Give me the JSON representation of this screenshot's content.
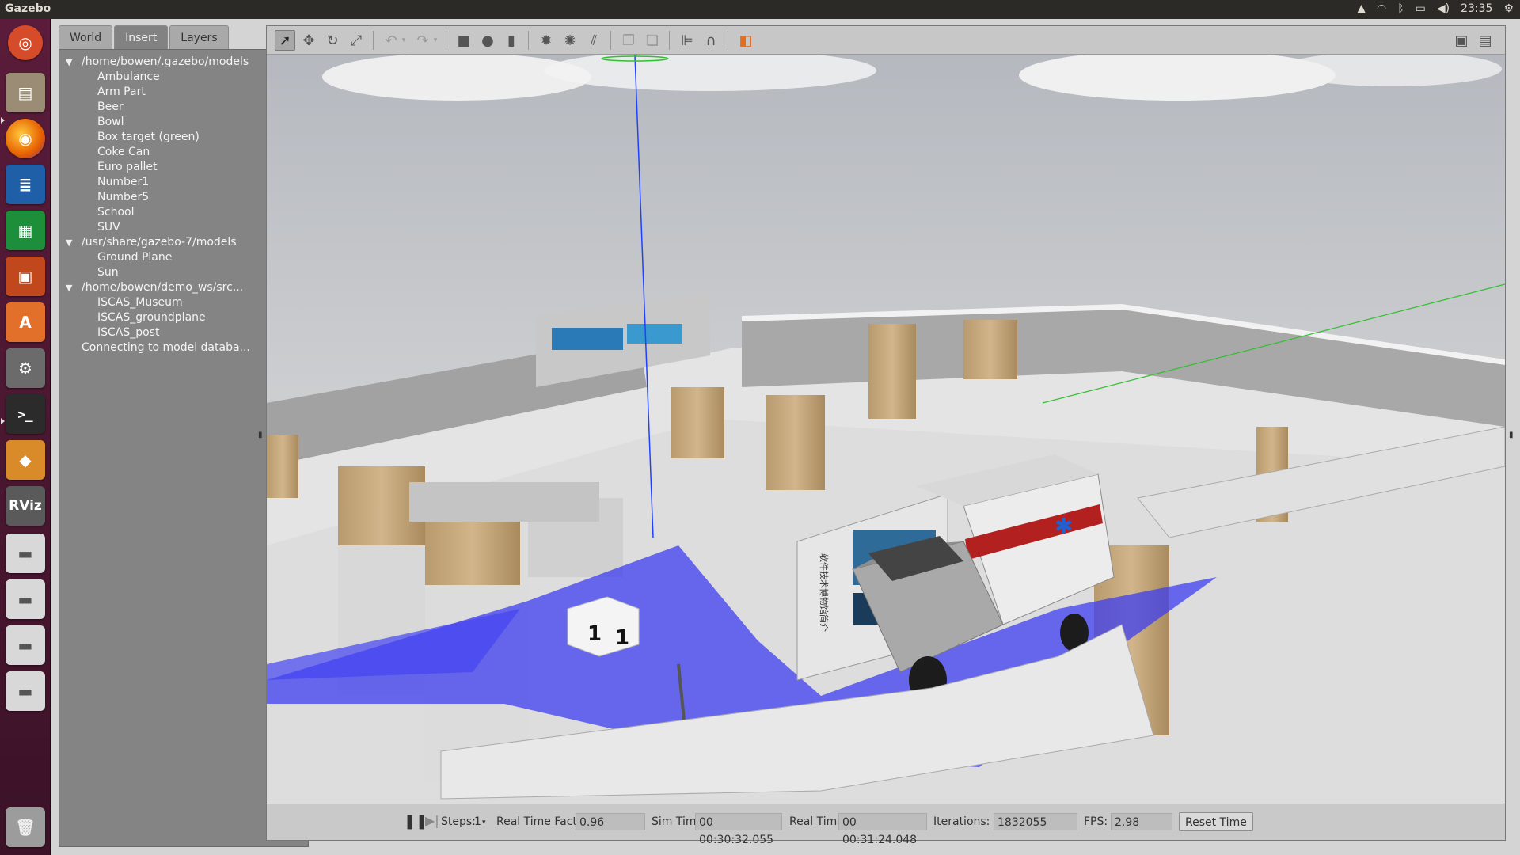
{
  "system": {
    "app_title": "Gazebo",
    "clock": "23:35",
    "tray_icons": [
      "update-icon",
      "wifi-icon",
      "bluetooth-icon",
      "battery-icon",
      "volume-icon",
      "settings-gear-icon"
    ]
  },
  "launcher": {
    "items": [
      {
        "name": "ubuntu-dash-icon",
        "color": "#d64b29"
      },
      {
        "name": "files-icon",
        "color": "#9b8c75"
      },
      {
        "name": "firefox-icon",
        "color": "#e66000"
      },
      {
        "name": "writer-icon",
        "color": "#1f5fa8"
      },
      {
        "name": "calc-icon",
        "color": "#1d8f3b"
      },
      {
        "name": "impress-icon",
        "color": "#c0481c"
      },
      {
        "name": "software-center-icon",
        "color": "#e2702a"
      },
      {
        "name": "system-settings-icon",
        "color": "#6b6b6b"
      },
      {
        "name": "terminal-icon",
        "color": "#2b2b2b"
      },
      {
        "name": "gazebo-icon",
        "color": "#d98b2a"
      },
      {
        "name": "rviz-icon",
        "color": "#5a5a5a"
      },
      {
        "name": "drive-icon",
        "color": "#d8d8d8"
      },
      {
        "name": "drive-icon",
        "color": "#d8d8d8"
      },
      {
        "name": "drive-icon",
        "color": "#d8d8d8"
      },
      {
        "name": "drive-icon",
        "color": "#d8d8d8"
      },
      {
        "name": "trash-icon",
        "color": "#9c9c9c"
      }
    ],
    "rviz_label": "RViz"
  },
  "left_panel": {
    "tabs": [
      {
        "label": "World",
        "active": false
      },
      {
        "label": "Insert",
        "active": true
      },
      {
        "label": "Layers",
        "active": false
      }
    ],
    "tree": [
      {
        "type": "path",
        "label": "/home/bowen/.gazebo/models"
      },
      {
        "type": "model",
        "label": "Ambulance"
      },
      {
        "type": "model",
        "label": "Arm Part"
      },
      {
        "type": "model",
        "label": "Beer"
      },
      {
        "type": "model",
        "label": "Bowl"
      },
      {
        "type": "model",
        "label": "Box target (green)"
      },
      {
        "type": "model",
        "label": "Coke Can"
      },
      {
        "type": "model",
        "label": "Euro pallet"
      },
      {
        "type": "model",
        "label": "Number1"
      },
      {
        "type": "model",
        "label": "Number5"
      },
      {
        "type": "model",
        "label": "School"
      },
      {
        "type": "model",
        "label": "SUV"
      },
      {
        "type": "path",
        "label": "/usr/share/gazebo-7/models"
      },
      {
        "type": "model",
        "label": "Ground Plane"
      },
      {
        "type": "model",
        "label": "Sun"
      },
      {
        "type": "path",
        "label": "/home/bowen/demo_ws/src..."
      },
      {
        "type": "model",
        "label": "ISCAS_Museum"
      },
      {
        "type": "model",
        "label": "ISCAS_groundplane"
      },
      {
        "type": "model",
        "label": "ISCAS_post"
      },
      {
        "type": "status",
        "label": "Connecting to model databa..."
      }
    ]
  },
  "toolbar": {
    "tools": [
      "select-arrow-icon",
      "translate-icon",
      "rotate-icon",
      "scale-icon",
      "undo-icon",
      "redo-icon",
      "box-icon",
      "sphere-icon",
      "cylinder-icon",
      "point-light-icon",
      "spot-light-icon",
      "directional-light-icon",
      "copy-icon",
      "paste-icon",
      "align-icon",
      "snap-icon",
      "view-angle-icon",
      "screenshot-icon",
      "log-icon"
    ],
    "selected": "select-arrow-icon"
  },
  "scene": {
    "cube_label": "1",
    "exhibit_caption": "软件技术博物馆简介"
  },
  "bottom_bar": {
    "steps_label": "Steps:",
    "steps_value": "1",
    "rtf_label": "Real Time Factor:",
    "rtf_value": "0.96",
    "sim_time_label": "Sim Time:",
    "sim_time_value": "00 00:30:32.055",
    "real_time_label": "Real Time:",
    "real_time_value": "00 00:31:24.048",
    "iterations_label": "Iterations:",
    "iterations_value": "1832055",
    "fps_label": "FPS:",
    "fps_value": "2.98",
    "reset_label": "Reset Time"
  }
}
